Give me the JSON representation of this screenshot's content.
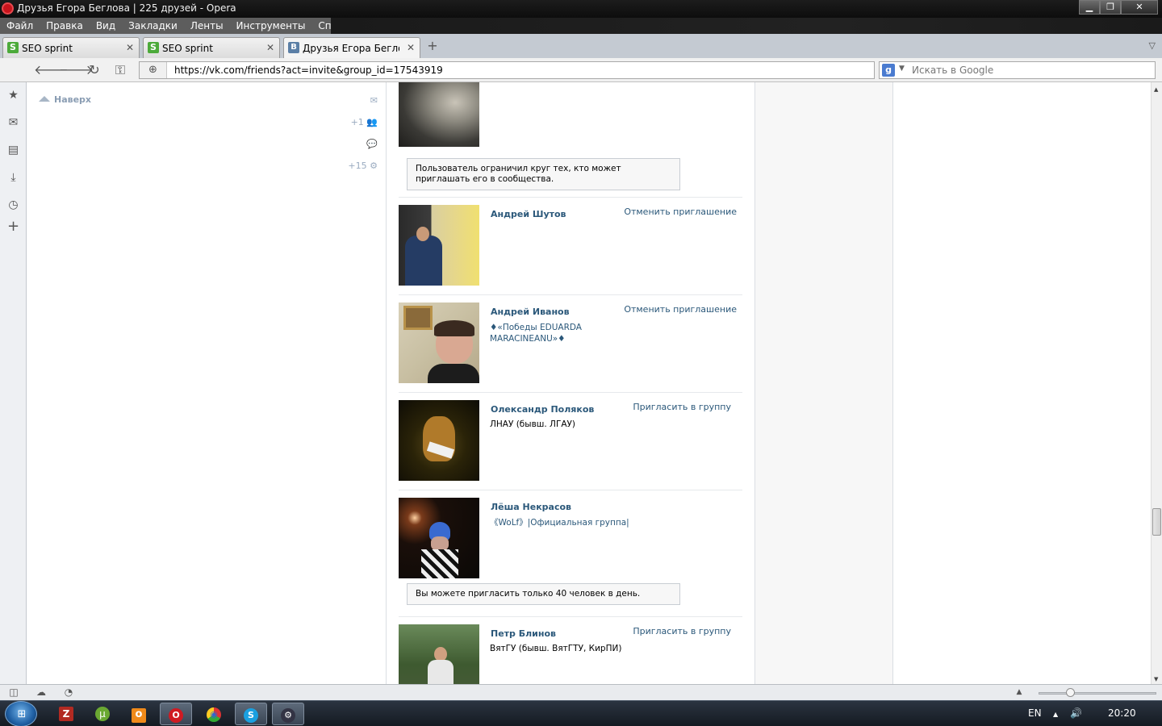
{
  "window": {
    "title": "Друзья Егора Беглова | 225 друзей - Opera",
    "min_glyph": "▁",
    "max_glyph": "❐",
    "close_glyph": "✕"
  },
  "menu": [
    "Файл",
    "Правка",
    "Вид",
    "Закладки",
    "Ленты",
    "Инструменты",
    "Справка"
  ],
  "tabs": [
    {
      "label": "SEO sprint",
      "favicon_glyph": "S",
      "close": "✕"
    },
    {
      "label": "SEO sprint",
      "favicon_glyph": "S",
      "close": "✕"
    },
    {
      "label": "Друзья Егора Беглова ...",
      "favicon_glyph": "B",
      "close": "✕"
    }
  ],
  "newtab_glyph": "+",
  "tabmenu_glyph": "▽",
  "nav": {
    "back": "🡐",
    "forward": "🡒",
    "reload": "↻",
    "key": "⚿",
    "site_glyph": "⊕",
    "url": "https://vk.com/friends?act=invite&group_id=17543919",
    "search_engine_glyph": "g",
    "search_dropdown": "▼",
    "search_placeholder": "Искать в Google"
  },
  "panel_icons": [
    {
      "name": "bookmarks-icon",
      "glyph": "★"
    },
    {
      "name": "mail-icon",
      "glyph": "✉"
    },
    {
      "name": "notes-icon",
      "glyph": "▤"
    },
    {
      "name": "downloads-icon",
      "glyph": "⤓"
    },
    {
      "name": "history-icon",
      "glyph": "◷"
    },
    {
      "name": "add-panel-icon",
      "glyph": "+"
    }
  ],
  "left": {
    "to_top": "Наверх",
    "messages_icon": "✉",
    "friends_count": "+1",
    "friends_icon": "👥",
    "comments_icon": "💬",
    "settings_count": "+15",
    "settings_icon": "⚙"
  },
  "friends": [
    {
      "name": "",
      "subtitle": "",
      "action": "",
      "notice": "Пользователь ограничил круг тех, кто может приглашать его в сообщества."
    },
    {
      "name": "Андрей Шутов",
      "subtitle": "",
      "action": "Отменить приглашение",
      "notice": ""
    },
    {
      "name": "Андрей Иванов",
      "subtitle": "♦«Победы EDUARDA MARACINEANU»♦",
      "action": "Отменить приглашение",
      "notice": ""
    },
    {
      "name": "Олександр Поляков",
      "subtitle": "ЛНАУ (бывш. ЛГАУ)",
      "action": "Пригласить в группу",
      "notice": ""
    },
    {
      "name": "Лёша Некрасов",
      "subtitle": "《WoLf》|Официальная группа|",
      "action": "",
      "notice": "Вы можете пригласить только 40 человек в день."
    },
    {
      "name": "Петр Блинов",
      "subtitle": "ВятГУ (бывш. ВятГТУ, КирПИ)",
      "action": "Пригласить в группу",
      "notice": ""
    }
  ],
  "statusbar": {
    "panel_toggle": "◫",
    "cloud": "☁",
    "speed": "◔",
    "zoom_up": "▲"
  },
  "taskbar": {
    "start_glyph": "⊞",
    "apps": [
      {
        "name": "filezilla",
        "glyph": "Z",
        "color": "#b22a22"
      },
      {
        "name": "utorrent",
        "glyph": "µ",
        "color": "#6aa832"
      },
      {
        "name": "odnoklassniki",
        "glyph": "о",
        "color": "#f08a1a"
      },
      {
        "name": "opera",
        "glyph": "O",
        "color": "#d01a22"
      },
      {
        "name": "chrome",
        "glyph": "◉",
        "color": "#e0b020"
      },
      {
        "name": "skype",
        "glyph": "S",
        "color": "#1aa0e0"
      },
      {
        "name": "steam",
        "glyph": "⚙",
        "color": "#334"
      }
    ],
    "lang": "EN",
    "tray_up": "▲",
    "volume": "🔊",
    "time": "20:20"
  }
}
